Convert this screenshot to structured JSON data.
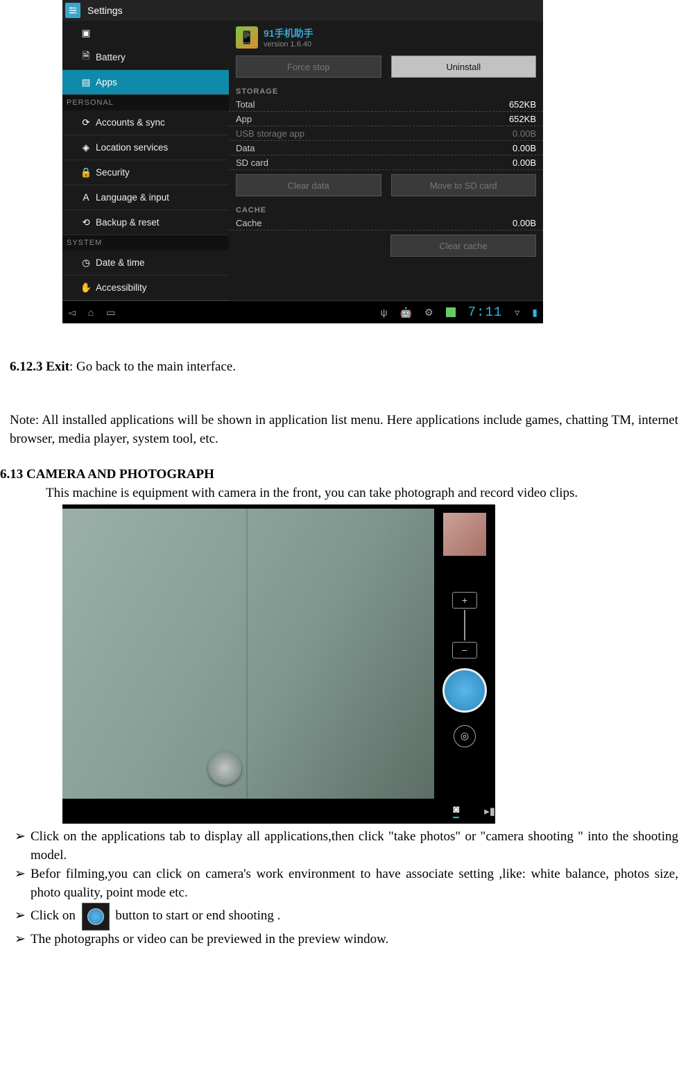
{
  "screenshot1": {
    "header": {
      "title": "Settings"
    },
    "sidebar": {
      "items_top": [
        {
          "label": "",
          "icon": "▣"
        },
        {
          "label": "Battery",
          "icon": "🗎"
        },
        {
          "label": "Apps",
          "icon": "▤",
          "selected": true
        }
      ],
      "cat1": "PERSONAL",
      "items_personal": [
        {
          "label": "Accounts & sync",
          "icon": "⟳"
        },
        {
          "label": "Location services",
          "icon": "◈"
        },
        {
          "label": "Security",
          "icon": "🔒"
        },
        {
          "label": "Language & input",
          "icon": "A"
        },
        {
          "label": "Backup & reset",
          "icon": "⟲"
        }
      ],
      "cat2": "SYSTEM",
      "items_system": [
        {
          "label": "Date & time",
          "icon": "◷"
        },
        {
          "label": "Accessibility",
          "icon": "✋"
        }
      ]
    },
    "detail": {
      "app_name": "91手机助手",
      "app_version": "version 1.6.40",
      "btn_force_stop": "Force stop",
      "btn_uninstall": "Uninstall",
      "section_storage": "STORAGE",
      "rows_storage": [
        {
          "k": "Total",
          "v": "652KB"
        },
        {
          "k": "App",
          "v": "652KB"
        },
        {
          "k": "USB storage app",
          "v": "0.00B",
          "dim": true
        },
        {
          "k": "Data",
          "v": "0.00B"
        },
        {
          "k": "SD card",
          "v": "0.00B"
        }
      ],
      "btn_clear_data": "Clear data",
      "btn_move_sd": "Move to SD card",
      "section_cache": "CACHE",
      "rows_cache": [
        {
          "k": "Cache",
          "v": "0.00B"
        }
      ],
      "btn_clear_cache": "Clear cache"
    },
    "navbar": {
      "time": "7:11"
    }
  },
  "doc": {
    "s6123_head": "6.12.3 Exit",
    "s6123_body": ": Go back to the main interface.",
    "note": "Note: All installed applications will be shown in application list menu. Here applications include games, chatting TM, internet browser, media player, system tool, etc.",
    "s613_head": "6.13 CAMERA AND PHOTOGRAPH",
    "s613_intro": "This machine is equipment with camera in the front, you can take photograph and record video clips.",
    "bullets": [
      "Click on the applications tab to display all applications,then click \"take photos\" or \"camera shooting \" into the shooting model.",
      "Befor filming,you can click on camera's work environment to have associate setting ,like: white balance, photos size, photo quality, point mode etc."
    ],
    "bullet3_pre": "Click on ",
    "bullet3_post": " button to start or end shooting .",
    "bullet4": "The photographs or video can be previewed in the preview window."
  },
  "camera": {
    "zoom_plus": "+",
    "zoom_minus": "−",
    "mode_photo": "◙",
    "mode_video": "▸▮"
  }
}
